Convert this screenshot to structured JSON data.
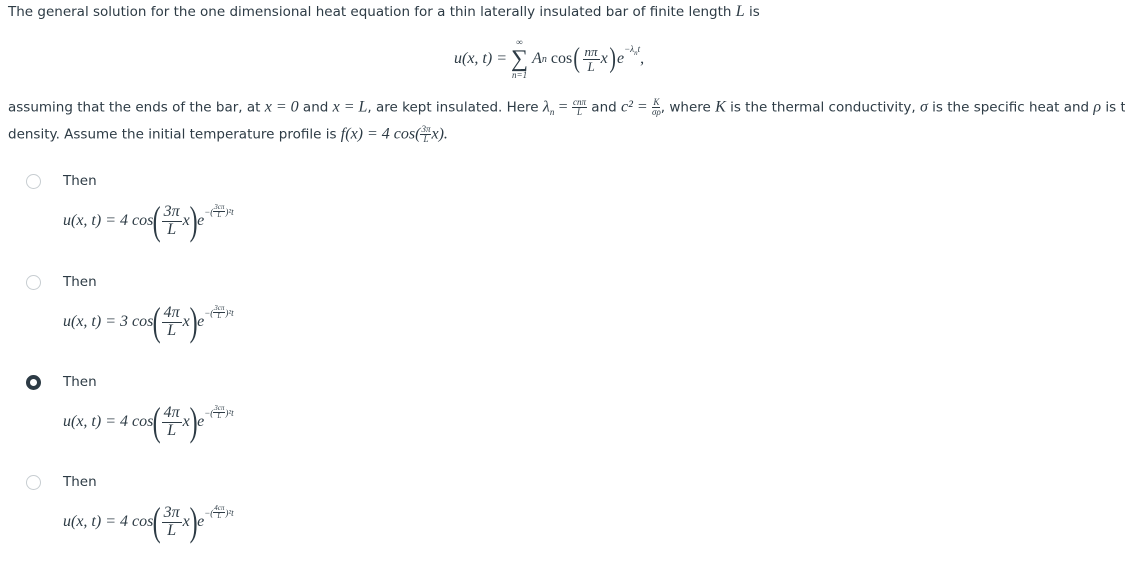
{
  "question": {
    "intro_text": "The general solution for the one dimensional heat equation for a thin laterally insulated bar of finite length",
    "intro_var": "L",
    "intro_tail": "is",
    "general_solution": {
      "lhs": "u(x, t) =",
      "sum_upper": "∞",
      "sum_lower": "n=1",
      "coef": "A",
      "coef_sub": "n",
      "cos": "cos",
      "frac_num": "nπ",
      "frac_den": "L",
      "var": "x",
      "exp_base": "e",
      "exp": "−λ",
      "exp_sub": "n",
      "exp_sup": "2",
      "exp_t": "t",
      "trailing": ","
    },
    "para2": {
      "p1": "assuming that the ends of the bar, at",
      "x_eq_0": "x = 0",
      "and1": "and",
      "x_eq_L": "x = L",
      "p2": ", are kept insulated. Here",
      "lambda": "λ",
      "lambda_sub": "n",
      "eq": "=",
      "lam_num": "cnπ",
      "lam_den": "L",
      "and2": "and",
      "c2": "c² =",
      "k_num": "K",
      "k_den": "σρ",
      "p3": ", where",
      "K": "K",
      "p4": "is the thermal conductivity,",
      "sigma": "σ",
      "p5": "is the specific heat and",
      "rho": "ρ",
      "p6": "is the"
    },
    "para3": {
      "p1": "density. Assume the initial temperature profile is",
      "f": "f(x) = 4 cos(",
      "num": "3π",
      "den": "L",
      "tail": "x)."
    }
  },
  "options": [
    {
      "label": "Then",
      "selected": false,
      "lhs": "u(x, t) = 4 cos",
      "num": "3π",
      "den": "L",
      "x": "x",
      "e": "e",
      "exp_prefix": "−(",
      "exp_num": "3cπ",
      "exp_den": "L",
      "exp_suffix": ")²t"
    },
    {
      "label": "Then",
      "selected": false,
      "lhs": "u(x, t) = 3 cos",
      "num": "4π",
      "den": "L",
      "x": "x",
      "e": "e",
      "exp_prefix": "−(",
      "exp_num": "3cπ",
      "exp_den": "L",
      "exp_suffix": ")²t"
    },
    {
      "label": "Then",
      "selected": true,
      "lhs": "u(x, t) = 4 cos",
      "num": "4π",
      "den": "L",
      "x": "x",
      "e": "e",
      "exp_prefix": "−(",
      "exp_num": "3cπ",
      "exp_den": "L",
      "exp_suffix": ")²t"
    },
    {
      "label": "Then",
      "selected": false,
      "lhs": "u(x, t) = 4 cos",
      "num": "3π",
      "den": "L",
      "x": "x",
      "e": "e",
      "exp_prefix": "−(",
      "exp_num": "4cπ",
      "exp_den": "L",
      "exp_suffix": ")²t"
    }
  ]
}
